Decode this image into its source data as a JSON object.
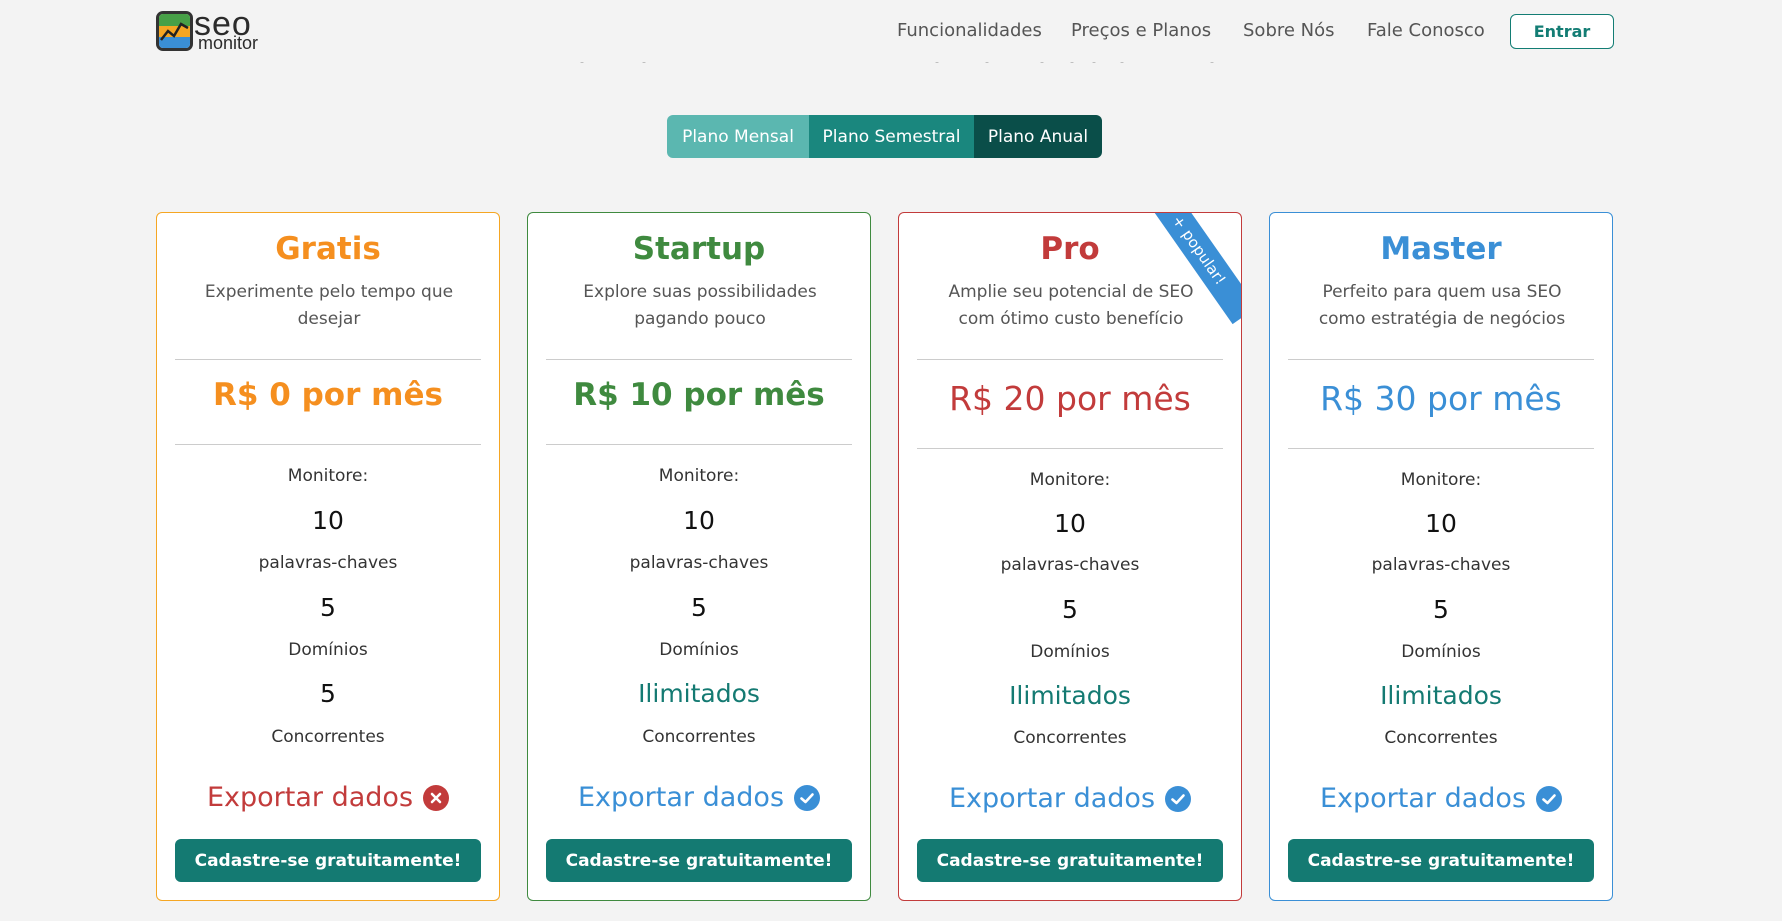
{
  "brand": {
    "line1": "seo",
    "line2": "monitor"
  },
  "nav": {
    "items": [
      "Funcionalidades",
      "Preços e Planos",
      "Sobre Nós",
      "Fale Conosco"
    ],
    "login_label": "Entrar"
  },
  "plan_toggle": {
    "monthly": "Plano Mensal",
    "semiannual": "Plano Semestral",
    "annual": "Plano Anual"
  },
  "labels": {
    "monitor": "Monitore:",
    "keywords": "palavras-chaves",
    "domains": "Domínios",
    "competitors": "Concorrentes",
    "export": "Exportar dados",
    "cta": "Cadastre-se gratuitamente!"
  },
  "plans": [
    {
      "name": "Gratis",
      "description": "Experimente pelo tempo que desejar",
      "price": "R$ 0 por mês",
      "keywords": "10",
      "domains": "5",
      "competitors": "5",
      "export_available": false,
      "color": "#f58f1f"
    },
    {
      "name": "Startup",
      "description": "Explore suas possibilidades pagando pouco",
      "price": "R$ 10 por mês",
      "keywords": "10",
      "domains": "5",
      "competitors": "Ilimitados",
      "export_available": true,
      "color": "#3f8a3f"
    },
    {
      "name": "Pro",
      "description": "Amplie seu potencial de SEO com ótimo custo benefício",
      "price": "R$ 20 por mês",
      "keywords": "10",
      "domains": "5",
      "competitors": "Ilimitados",
      "export_available": true,
      "color": "#c23b3b",
      "badge": "+ popular!"
    },
    {
      "name": "Master",
      "description": "Perfeito para quem usa SEO como estratégia de negócios",
      "price": "R$ 30 por mês",
      "keywords": "10",
      "domains": "5",
      "competitors": "Ilimitados",
      "export_available": true,
      "color": "#3a8fd6"
    }
  ],
  "colors": {
    "primary": "#147a72",
    "export_no": "#c23b3b",
    "export_yes": "#3a8fd6"
  }
}
